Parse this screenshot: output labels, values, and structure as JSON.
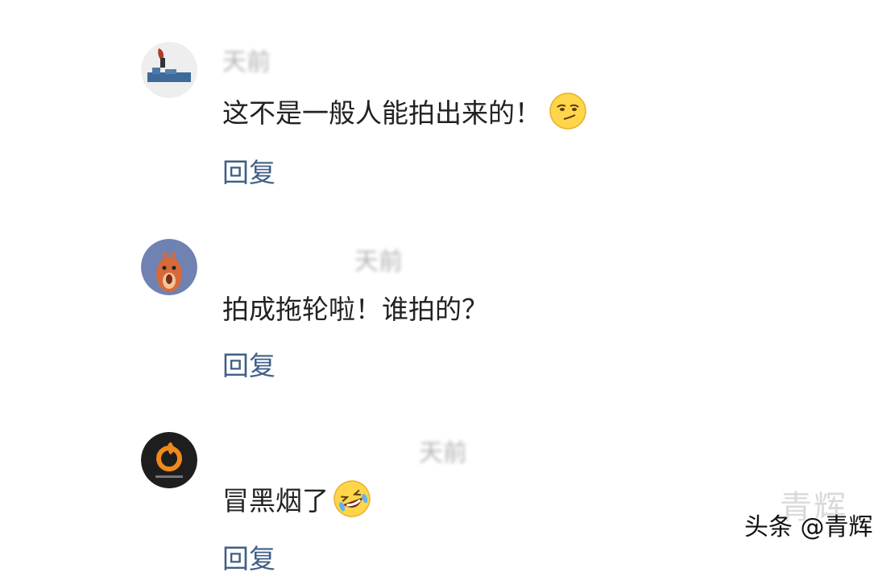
{
  "comments": [
    {
      "meta": "天前",
      "text": "这不是一般人能拍出来的！",
      "emoji": "smirk-emoji-icon",
      "reply_label": "回复"
    },
    {
      "meta": "天前",
      "text": "拍成拖轮啦！谁拍的？",
      "emoji": "",
      "reply_label": "回复"
    },
    {
      "meta": "天前",
      "text": "冒黑烟了",
      "emoji": "rofl-emoji-icon",
      "reply_label": "回复"
    }
  ],
  "watermark": "青辉",
  "brand": "头条 @青辉",
  "colors": {
    "reply": "#3f5f86",
    "text": "#222222",
    "meta": "#9a9a9a"
  }
}
